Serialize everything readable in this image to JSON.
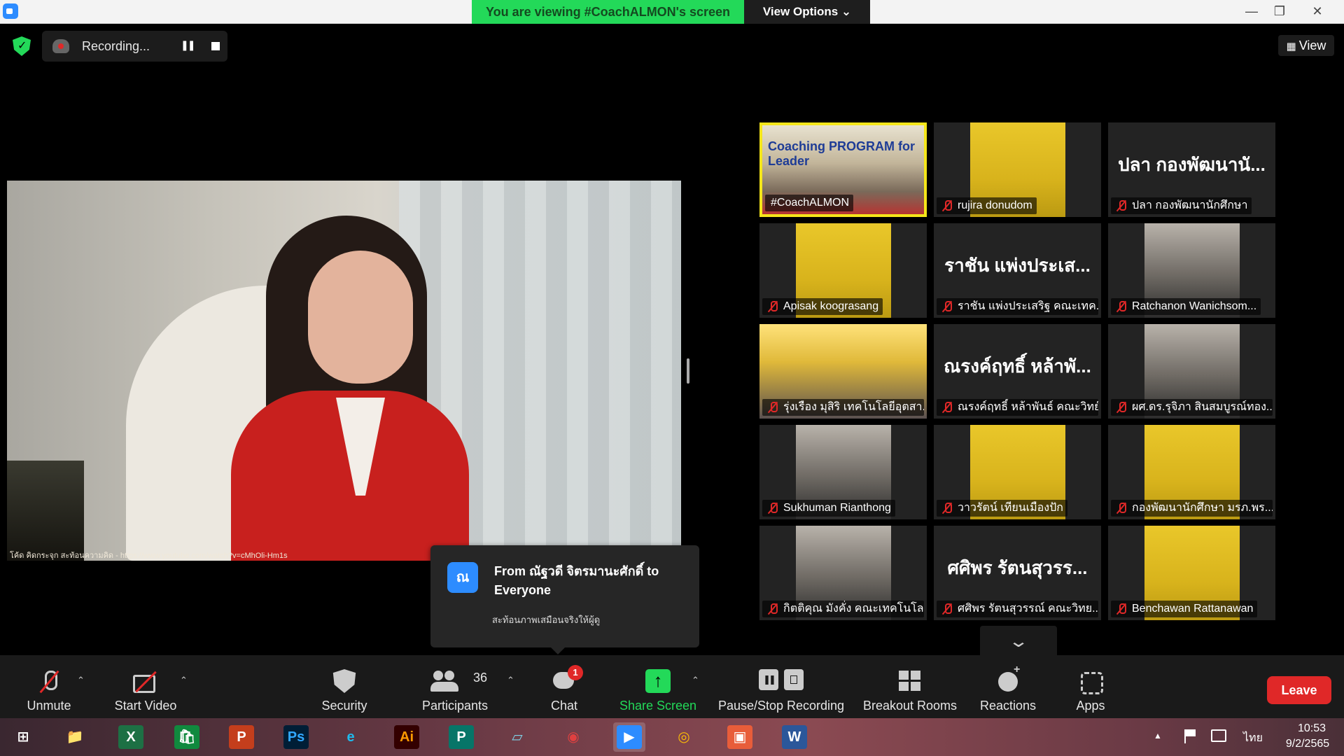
{
  "title_bar": {
    "viewing_banner": "You are viewing #CoachALMON's screen",
    "view_options": "View Options ⌄",
    "minimize": "—",
    "restore": "❐",
    "close": "✕"
  },
  "top_bar": {
    "recording_label": "Recording...",
    "pause_glyph": "❚❚",
    "view_label": "View",
    "view_glyph": "▦"
  },
  "shared_screen": {
    "caption": "โค้ด คิดกระจุก สะท้อนความคิด - https://www.youtube.com/watch?v=cMhOli-Hm1s"
  },
  "gallery": {
    "tiles": [
      {
        "name": "#CoachALMON",
        "muted": false,
        "type": "video",
        "active": true,
        "overlay": "Coaching PROGRAM for Leader"
      },
      {
        "name": "rujira donudom",
        "muted": true,
        "type": "avatar"
      },
      {
        "name": "ปลา กองพัฒนานักศึกษา",
        "muted": true,
        "type": "name",
        "big": "ปลา กองพัฒนานั..."
      },
      {
        "name": "Apisak koograsang",
        "muted": true,
        "type": "avatar"
      },
      {
        "name": "ราชัน แพ่งประเสริฐ คณะเทค...",
        "muted": true,
        "type": "name",
        "big": "ราชัน แพ่งประเส..."
      },
      {
        "name": "Ratchanon Wanichsom...",
        "muted": true,
        "type": "photo"
      },
      {
        "name": "รุ่งเรือง มุสิริ เทคโนโลยีอุตสา...",
        "muted": true,
        "type": "poster"
      },
      {
        "name": "ณรงค์ฤทธิ์ หล้าพันธ์ คณะวิทย์",
        "muted": true,
        "type": "name",
        "big": "ณรงค์ฤทธิ์ หล้าพั..."
      },
      {
        "name": "ผศ.ดร.รุจิภา สินสมบูรณ์ทอง...",
        "muted": true,
        "type": "photo"
      },
      {
        "name": "Sukhuman Rianthong",
        "muted": true,
        "type": "photo"
      },
      {
        "name": "วาวรัตน์ เทียนเมืองปัก",
        "muted": true,
        "type": "avatar"
      },
      {
        "name": "กองพัฒนานักศึกษา มรภ.พร...",
        "muted": true,
        "type": "avatar"
      },
      {
        "name": "กิตติคุณ มังคั่ง คณะเทคโนโล...",
        "muted": true,
        "type": "photo"
      },
      {
        "name": "ศศิพร รัตนสุวรรณ์ คณะวิทย...",
        "muted": true,
        "type": "name",
        "big": "ศศิพร รัตนสุวรร..."
      },
      {
        "name": "Benchawan Rattanawan",
        "muted": true,
        "type": "avatar"
      }
    ],
    "scroll_glyph": "⌄"
  },
  "chat_popup": {
    "avatar_letter": "ณ",
    "from": "From ณัฐวดี จิตรมานะศักดิ์ to Everyone",
    "message": "สะท้อนภาพเสมือนจริงให้ผู้ดู"
  },
  "toolbar": {
    "unmute": "Unmute",
    "start_video": "Start Video",
    "security": "Security",
    "participants": "Participants",
    "participants_count": "36",
    "chat": "Chat",
    "chat_badge": "1",
    "share_screen": "Share Screen",
    "pause_stop_recording": "Pause/Stop Recording",
    "breakout_rooms": "Breakout Rooms",
    "reactions": "Reactions",
    "apps": "Apps",
    "leave": "Leave",
    "caret": "⌃"
  },
  "taskbar": {
    "apps": [
      {
        "name": "windows-start",
        "glyph": "⊞",
        "color": "#ffffff",
        "bg": "transparent"
      },
      {
        "name": "file-explorer",
        "glyph": "📁",
        "color": "#f5c542",
        "bg": "transparent"
      },
      {
        "name": "excel",
        "glyph": "X",
        "color": "#ffffff",
        "bg": "#1d7044"
      },
      {
        "name": "store",
        "glyph": "🛍",
        "color": "#ffffff",
        "bg": "#10893e"
      },
      {
        "name": "powerpoint",
        "glyph": "P",
        "color": "#ffffff",
        "bg": "#c43e1c"
      },
      {
        "name": "photoshop",
        "glyph": "Ps",
        "color": "#31a8ff",
        "bg": "#001e36"
      },
      {
        "name": "internet-explorer",
        "glyph": "e",
        "color": "#1ebbee",
        "bg": "transparent"
      },
      {
        "name": "illustrator",
        "glyph": "Ai",
        "color": "#ff9a00",
        "bg": "#330000"
      },
      {
        "name": "publisher",
        "glyph": "P",
        "color": "#ffffff",
        "bg": "#077568"
      },
      {
        "name": "notes-app",
        "glyph": "▱",
        "color": "#7fd3e8",
        "bg": "transparent"
      },
      {
        "name": "photoscape",
        "glyph": "◉",
        "color": "#e04040",
        "bg": "transparent"
      },
      {
        "name": "zoom",
        "glyph": "▶",
        "color": "#ffffff",
        "bg": "#2d8cff"
      },
      {
        "name": "chrome",
        "glyph": "◎",
        "color": "#fbbc05",
        "bg": "transparent"
      },
      {
        "name": "photos",
        "glyph": "▣",
        "color": "#ffffff",
        "bg": "#e85d3a"
      },
      {
        "name": "word",
        "glyph": "W",
        "color": "#ffffff",
        "bg": "#2b579a"
      }
    ],
    "tray_up": "▲",
    "language": "ไทย",
    "time": "10:53",
    "date": "9/2/2565"
  }
}
